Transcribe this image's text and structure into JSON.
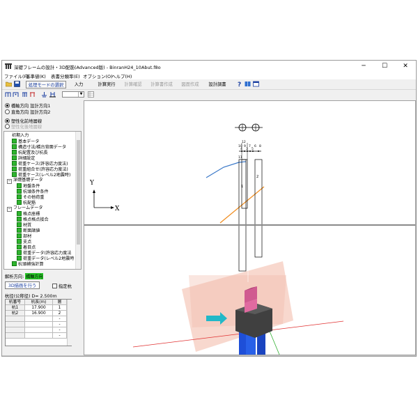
{
  "window": {
    "title": "深礎フレームの設計・3D配筋(Advanced版) - BinranH24_10Abut.f8o",
    "minimize": "─",
    "maximize": "☐",
    "close": "✕"
  },
  "menu": [
    "ファイル(F)",
    "基準値(K)",
    "表書分類率(E)",
    "オプション(O)",
    "ヘルプ(H)"
  ],
  "toolbar": {
    "mode_button": "処理モードの選択",
    "buttons": [
      {
        "label": "入力",
        "enabled": true
      },
      {
        "label": "計算実行",
        "enabled": true
      },
      {
        "label": "計算確認",
        "enabled": false
      },
      {
        "label": "計算書作成",
        "enabled": false
      },
      {
        "label": "図面作成",
        "enabled": false
      },
      {
        "label": "設計調書",
        "enabled": true
      }
    ]
  },
  "left_panel": {
    "direction_radios": [
      {
        "label": "橋軸方向 設計方向1",
        "selected": true
      },
      {
        "label": "直角方向 設計方向2",
        "selected": false
      }
    ],
    "state_radios": [
      {
        "label": "塑性化前地層線",
        "selected": true
      },
      {
        "label": "塑性化後地層線",
        "selected": false,
        "disabled": true
      }
    ],
    "tree": [
      {
        "label": "初期入力",
        "level": 1,
        "type": "none"
      },
      {
        "label": "基本データ",
        "level": 1,
        "type": "sq"
      },
      {
        "label": "構造寸法/橋台背面データ",
        "level": 1,
        "type": "sq"
      },
      {
        "label": "杭配置及び杭長",
        "level": 1,
        "type": "sq"
      },
      {
        "label": "詳細設定",
        "level": 1,
        "type": "sq"
      },
      {
        "label": "荷重ケース(許容応力度法)",
        "level": 1,
        "type": "sq"
      },
      {
        "label": "荷重組合せ(許容応力度法)",
        "level": 1,
        "type": "sq"
      },
      {
        "label": "荷重ケース(レベル2地震時)",
        "level": 1,
        "type": "sq"
      },
      {
        "label": "深礎基礎データ",
        "level": 0,
        "type": "box"
      },
      {
        "label": "地盤条件",
        "level": 2,
        "type": "sq"
      },
      {
        "label": "杭頭条件条件",
        "level": 2,
        "type": "sq"
      },
      {
        "label": "その他荷重",
        "level": 2,
        "type": "sq"
      },
      {
        "label": "杭配筋",
        "level": 2,
        "type": "sq"
      },
      {
        "label": "フレームデータ",
        "level": 0,
        "type": "box"
      },
      {
        "label": "格点座標",
        "level": 2,
        "type": "sq"
      },
      {
        "label": "格点格点接合",
        "level": 2,
        "type": "sq"
      },
      {
        "label": "材質",
        "level": 2,
        "type": "sq"
      },
      {
        "label": "断面諸値",
        "level": 2,
        "type": "sq"
      },
      {
        "label": "部材",
        "level": 2,
        "type": "sq"
      },
      {
        "label": "支点",
        "level": 2,
        "type": "sq"
      },
      {
        "label": "着目点",
        "level": 2,
        "type": "sq"
      },
      {
        "label": "荷重データ(許容応力度法",
        "level": 2,
        "type": "sq"
      },
      {
        "label": "荷重データ(レベル2地震時",
        "level": 2,
        "type": "sq"
      },
      {
        "label": "杭頭補強計算",
        "level": 1,
        "type": "sq"
      }
    ],
    "analysis_label": "解析方向:",
    "analysis_value": "橋軸方向",
    "view3d_button": "3D描画を行う",
    "fixed_check": "指定杭",
    "pile_diameter": "杭径(公称径) D= 2.500m",
    "grid": {
      "headers": [
        "杭番号",
        "杭長(m)",
        "層"
      ],
      "rows": [
        [
          "杭1",
          "17.900",
          "1"
        ],
        [
          "杭2",
          "16.900",
          "2"
        ],
        [
          "",
          "",
          "-"
        ],
        [
          "",
          "",
          "-"
        ],
        [
          "",
          "",
          "-"
        ],
        [
          "",
          "",
          "-"
        ]
      ]
    }
  },
  "view2d": {
    "axis_x": "X",
    "axis_y": "Y",
    "pile_labels": [
      "1",
      "2"
    ],
    "node_labels": [
      "12",
      "10",
      "9",
      "7",
      "6",
      "8",
      "4",
      "3",
      "5",
      "1",
      "2",
      "11",
      "10"
    ]
  },
  "colors": {
    "accent_blue": "#1a3ea0",
    "tree_green": "#2fb52f",
    "pile_blue": "#1e4fd8",
    "cap_gray": "#404040",
    "column_pink": "#e06aa0",
    "plane_pink": "#f2b8a6",
    "load_arrow": "#22b8c8"
  }
}
